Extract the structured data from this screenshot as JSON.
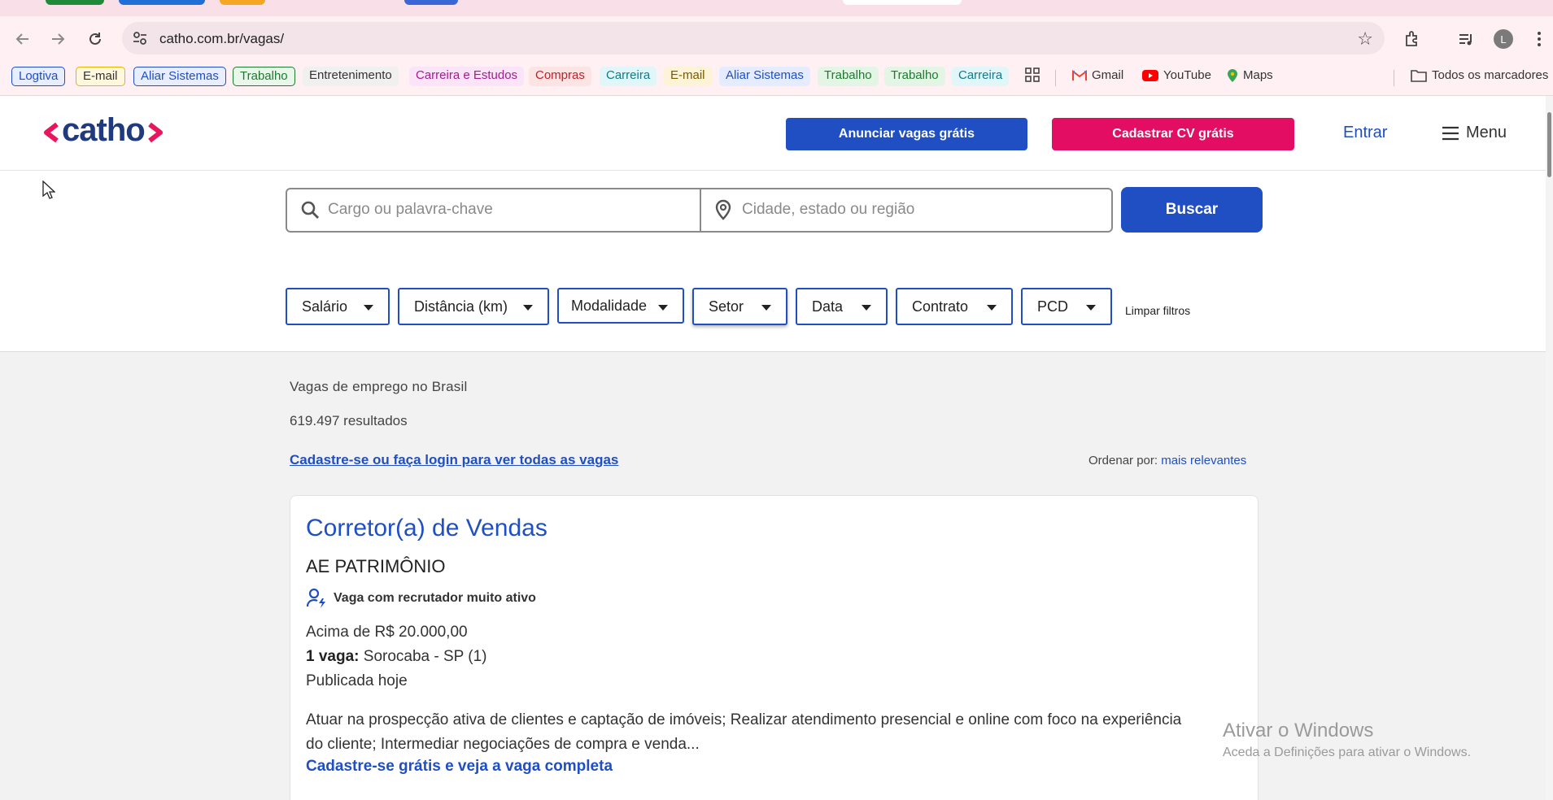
{
  "browser": {
    "url": "catho.com.br/vagas/",
    "avatar_initial": "L",
    "bookmarks": [
      {
        "label": "Logtiva",
        "color": "#1f4fc3",
        "bg": "#e8eeff",
        "style": "outlined"
      },
      {
        "label": "E-mail",
        "color": "#333333",
        "bg": "#fff8dd",
        "border": "#e8b400",
        "style": "outlined"
      },
      {
        "label": "Aliar Sistemas",
        "color": "#1f4fc3",
        "bg": "#e8eeff",
        "style": "outlined"
      },
      {
        "label": "Trabalho",
        "color": "#1e7a2e",
        "bg": "#e8f7ea",
        "style": "outlined"
      },
      {
        "label": "Entretenimento",
        "color": "#333333",
        "bg": "#f0f0f0",
        "style": "plain"
      },
      {
        "label": "Carreira e Estudos",
        "color": "#a01f8a",
        "bg": "#fbe4f7",
        "style": "plain"
      },
      {
        "label": "Compras",
        "color": "#c0202a",
        "bg": "#fde4e4",
        "style": "plain"
      },
      {
        "label": "Carreira",
        "color": "#137a8a",
        "bg": "#e0f6f8",
        "style": "plain"
      },
      {
        "label": "E-mail",
        "color": "#7a5a00",
        "bg": "#fdf3d6",
        "style": "plain"
      },
      {
        "label": "Aliar Sistemas",
        "color": "#1f4fc3",
        "bg": "#e6ecff",
        "style": "plain"
      },
      {
        "label": "Trabalho",
        "color": "#1e7a2e",
        "bg": "#e3f6e6",
        "style": "plain"
      },
      {
        "label": "Trabalho",
        "color": "#1e7a2e",
        "bg": "#e3f6e6",
        "style": "plain"
      },
      {
        "label": "Carreira",
        "color": "#137a8a",
        "bg": "#e0f6f8",
        "style": "plain"
      }
    ],
    "app_links": [
      {
        "label": "Gmail",
        "icon": "gmail-icon"
      },
      {
        "label": "YouTube",
        "icon": "youtube-icon"
      },
      {
        "label": "Maps",
        "icon": "maps-icon"
      }
    ],
    "all_bookmarks_label": "Todos os marcadores"
  },
  "header": {
    "logo_text": "catho",
    "advertise_button": "Anunciar vagas grátis",
    "register_cv_button": "Cadastrar CV grátis",
    "login_link": "Entrar",
    "menu_label": "Menu"
  },
  "search": {
    "keyword_placeholder": "Cargo ou palavra-chave",
    "location_placeholder": "Cidade, estado ou região",
    "search_button": "Buscar"
  },
  "filters": {
    "items": [
      "Salário",
      "Distância (km)",
      "Modalidade",
      "Setor",
      "Data",
      "Contrato",
      "PCD"
    ],
    "clear_label": "Limpar filtros"
  },
  "results": {
    "heading": "Vagas de emprego no Brasil",
    "count": "619.497 resultados",
    "login_prompt": "Cadastre-se ou faça login para ver todas as vagas",
    "sort_label": "Ordenar por:",
    "sort_value": "mais relevantes"
  },
  "job": {
    "title": "Corretor(a) de Vendas",
    "company": "AE PATRIMÔNIO",
    "recruiter_badge": "Vaga com recrutador muito ativo",
    "salary": "Acima de R$ 20.000,00",
    "openings_label": "1 vaga:",
    "location": "Sorocaba - SP (1)",
    "published": "Publicada hoje",
    "description": "Atuar na prospecção ativa de clientes e captação de imóveis; Realizar atendimento presencial e online com foco na experiência do cliente; Intermediar negociações de compra e venda...",
    "cta": "Cadastre-se grátis e veja a vaga completa"
  },
  "windows_watermark": {
    "line1": "Ativar o Windows",
    "line2": "Aceda a Definições para ativar o Windows."
  },
  "colors": {
    "brand_blue": "#1f4fc3",
    "brand_pink": "#e30d63",
    "logo_navy": "#203a7e"
  }
}
